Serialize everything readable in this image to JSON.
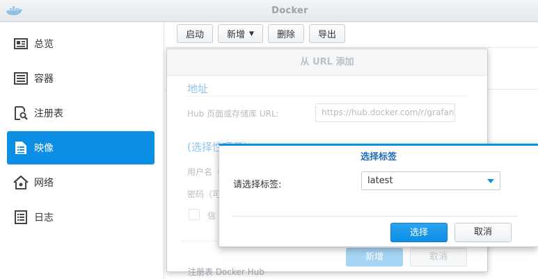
{
  "app": {
    "title": "Docker",
    "logo_icon": "docker-whale-icon"
  },
  "sidebar": {
    "items": [
      {
        "label": "总览",
        "icon": "overview-card-icon",
        "active": false
      },
      {
        "label": "容器",
        "icon": "container-list-icon",
        "active": false
      },
      {
        "label": "注册表",
        "icon": "registry-search-icon",
        "active": false
      },
      {
        "label": "映像",
        "icon": "image-list-icon",
        "active": true
      },
      {
        "label": "网络",
        "icon": "network-house-icon",
        "active": false
      },
      {
        "label": "日志",
        "icon": "log-list-icon",
        "active": false
      }
    ]
  },
  "toolbar": {
    "launch": "启动",
    "add": "新增",
    "delete": "删除",
    "export": "导出"
  },
  "url_dialog": {
    "title": "从 URL 添加",
    "section_address": "地址",
    "url_label": "Hub 页面或存储库 URL:",
    "url_value": "https://hub.docker.com/r/grafana/grafana",
    "section_optional": "(选择性项目)",
    "username_label": "用户名（",
    "password_label": "密码（可",
    "checkbox_label": "信",
    "add_button": "新增",
    "cancel_button": "取消",
    "behind_text": "注册表 Docker Hub"
  },
  "tag_dialog": {
    "title": "选择标签",
    "label": "请选择标签:",
    "selected_tag": "latest",
    "ok_button": "选择",
    "cancel_button": "取消"
  },
  "colors": {
    "accent": "#0c8ee5",
    "dialog_title": "#1f6fb5"
  }
}
